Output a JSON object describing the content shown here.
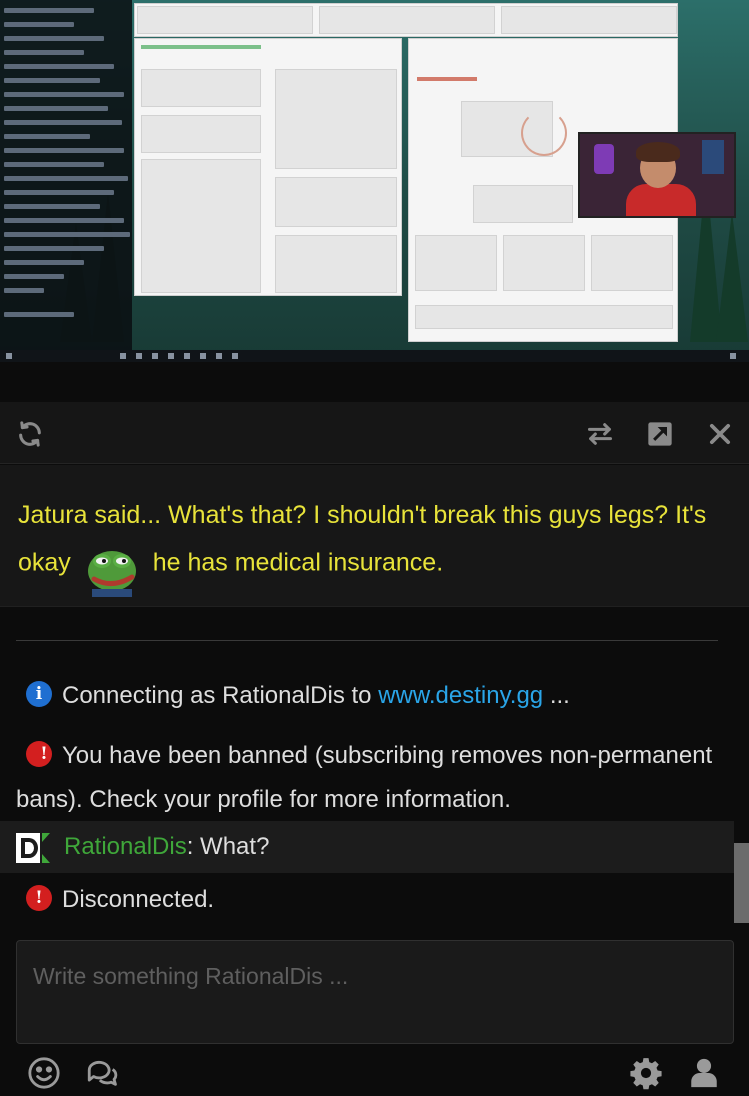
{
  "pinned_message": {
    "before_emote": "Jatura said... What's that? I shouldn't break this guys legs? It's okay",
    "emote_icon": "pepe-frog-emote",
    "after_emote": "he has medical insurance."
  },
  "messages": {
    "connect": {
      "icon": "info-icon",
      "icon_glyph": "i",
      "prefix": "Connecting as RationalDis to",
      "link": "www.destiny.gg",
      "suffix": "..."
    },
    "banned": {
      "icon": "error-icon",
      "icon_glyph": "!",
      "text": "You have been banned (subscribing removes non-permanent bans). Check your profile for more information."
    },
    "user": {
      "flair_icon": "destiny-d-flair-icon",
      "nick": "RationalDis",
      "separator": ":",
      "text": " What?"
    },
    "disconnected": {
      "icon": "error-icon",
      "icon_glyph": "!",
      "text": "Disconnected."
    }
  },
  "input": {
    "placeholder": "Write something RationalDis ..."
  },
  "toolbar": {
    "left": [
      "refresh-icon"
    ],
    "right": [
      "swap-icon",
      "popout-icon",
      "close-icon"
    ]
  },
  "bottom_bar": {
    "left": [
      "emote-smiley-icon",
      "whispers-icon"
    ],
    "right": [
      "settings-gear-icon",
      "user-list-icon"
    ]
  },
  "colors": {
    "pinned_text": "#e8e33a",
    "link": "#2aa5e8",
    "nick": "#3fa73a",
    "info_icon": "#1f6fd1",
    "error_icon": "#d31f1f",
    "background": "#0c0c0c"
  }
}
